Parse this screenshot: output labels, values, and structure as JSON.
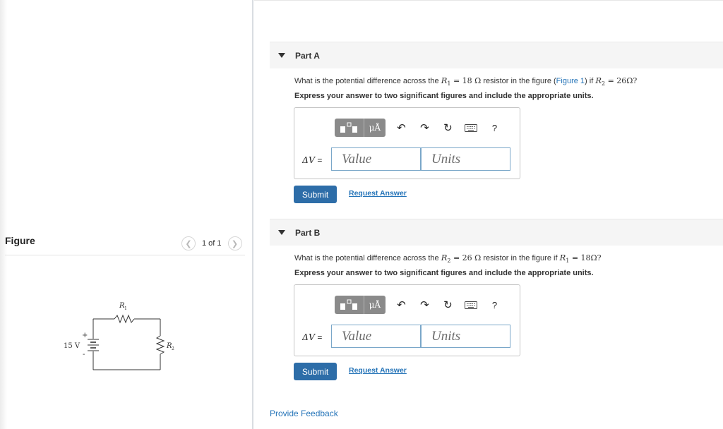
{
  "figure": {
    "title": "Figure",
    "pager": {
      "text": "1 of 1"
    },
    "circuit": {
      "source_label": "15 V",
      "plus": "+",
      "minus": "-",
      "r1_label": "R",
      "r1_sub": "1",
      "r2_label": "R",
      "r2_sub": "2"
    }
  },
  "part_a": {
    "title": "Part A",
    "q_pre": "What is the potential difference across the ",
    "q_r1_sym": "R",
    "q_r1_sub": "1",
    "q_eq1": " = 18 Ω",
    "q_mid": " resistor in the figure (",
    "q_link": "Figure 1",
    "q_mid2": ") if ",
    "q_r2_sym": "R",
    "q_r2_sub": "2",
    "q_eq2": " = 26Ω?",
    "instruction": "Express your answer to two significant figures and include the appropriate units.",
    "toolbar": {
      "mu_label": "μÅ",
      "undo": "↶",
      "redo": "↷",
      "reset": "↻",
      "help": "?"
    },
    "dv_symbol": "ΔV",
    "dv_eq": " =",
    "value_placeholder": "Value",
    "units_placeholder": "Units",
    "submit_label": "Submit",
    "request_label": "Request Answer"
  },
  "part_b": {
    "title": "Part B",
    "q_pre": "What is the potential difference across the ",
    "q_r2_sym": "R",
    "q_r2_sub": "2",
    "q_eq2": " = 26 Ω",
    "q_mid": " resistor in the figure if ",
    "q_r1_sym": "R",
    "q_r1_sub": "1",
    "q_eq1": " = 18Ω?",
    "instruction": "Express your answer to two significant figures and include the appropriate units.",
    "toolbar": {
      "mu_label": "μÅ",
      "undo": "↶",
      "redo": "↷",
      "reset": "↻",
      "help": "?"
    },
    "dv_symbol": "ΔV",
    "dv_eq": " =",
    "value_placeholder": "Value",
    "units_placeholder": "Units",
    "submit_label": "Submit",
    "request_label": "Request Answer"
  },
  "feedback_label": "Provide Feedback"
}
